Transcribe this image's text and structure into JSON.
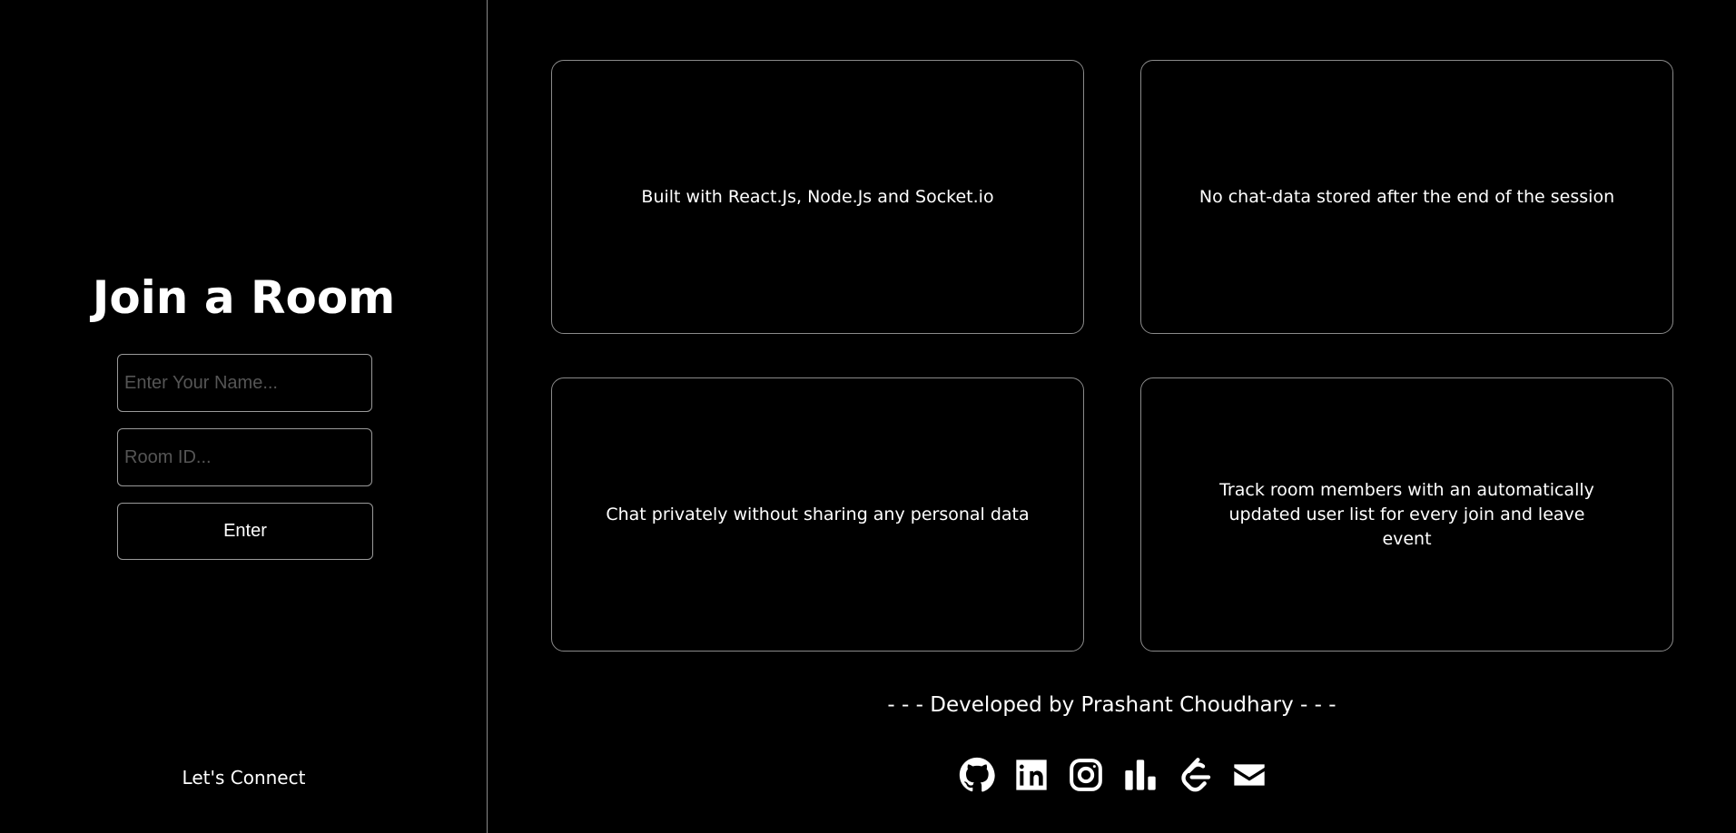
{
  "left_panel": {
    "title": "Join a Room",
    "name_placeholder": "Enter Your Name...",
    "room_placeholder": "Room ID...",
    "enter_label": "Enter",
    "connect_label": "Let's Connect"
  },
  "features": [
    {
      "text": "Built with React.Js, Node.Js and Socket.io"
    },
    {
      "text": "No chat-data stored after the end of the session"
    },
    {
      "text": "Chat privately without sharing any personal data"
    },
    {
      "text": "Track room members with an automatically updated user list for every join and leave event"
    }
  ],
  "footer": {
    "credit": "- - - Developed by Prashant Choudhary - - -"
  },
  "socials": [
    {
      "icon": "github-icon"
    },
    {
      "icon": "linkedin-icon"
    },
    {
      "icon": "instagram-icon"
    },
    {
      "icon": "bar-chart-icon"
    },
    {
      "icon": "leetcode-icon"
    },
    {
      "icon": "mail-icon"
    }
  ],
  "colors": {
    "background": "#000000",
    "text": "#ffffff",
    "border": "#8a8a8a"
  }
}
